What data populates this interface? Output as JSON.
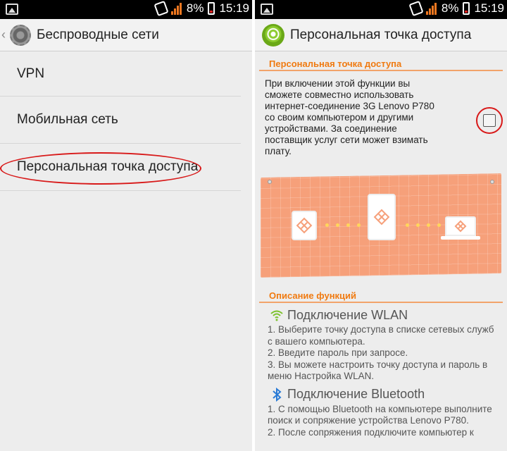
{
  "status_bar": {
    "battery_percent": "8%",
    "time": "15:19"
  },
  "left": {
    "title": "Беспроводные сети",
    "menu_items": [
      "VPN",
      "Мобильная сеть",
      "Персональная точка доступа"
    ]
  },
  "right": {
    "title": "Персональная точка доступа",
    "section_hotspot": "Персональная точка доступа",
    "hotspot_description": "При включении этой функции вы сможете совместно использовать интернет-соединение 3G Lenovo P780 со своим компьютером и другими устройствами. За соединение поставщик услуг сети может взимать плату.",
    "hotspot_enabled": false,
    "section_features": "Описание функций",
    "wlan": {
      "title": "Подключение WLAN",
      "steps": [
        "1. Выберите точку доступа в списке сетевых служб с вашего компьютера.",
        "2. Введите пароль при запросе.",
        "3. Вы можете настроить точку доступа и пароль в меню Настройка WLAN."
      ]
    },
    "bluetooth": {
      "title": "Подключение Bluetooth",
      "steps": [
        "1. С помощью Bluetooth на компьютере выполните поиск и сопряжение устройства Lenovo P780.",
        "2. После сопряжения подключите компьютер к"
      ]
    }
  },
  "icons": {
    "left_header": "gear-icon",
    "right_header": "hotspot-icon",
    "wlan": "wifi-icon",
    "bluetooth": "bluetooth-icon"
  },
  "colors": {
    "accent_orange": "#f07a10",
    "highlight_red": "#d81919",
    "illustration_bg": "#f6a07a"
  }
}
